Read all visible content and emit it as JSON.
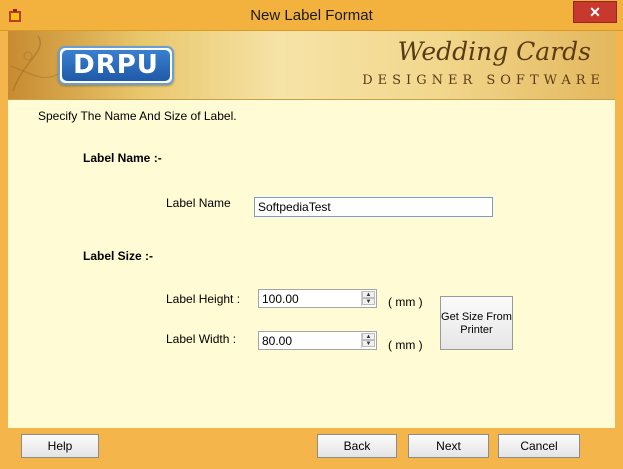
{
  "window": {
    "title": "New Label Format",
    "close_glyph": "✕"
  },
  "banner": {
    "logo_text": "DRPU",
    "brand_title": "Wedding Cards",
    "brand_subtitle": "DESIGNER SOFTWARE"
  },
  "content": {
    "instruction": "Specify The Name And Size of Label.",
    "name_section": {
      "heading": "Label Name :-",
      "field_label": "Label Name",
      "field_value": "SoftpediaTest"
    },
    "size_section": {
      "heading": "Label Size :-",
      "height_label": "Label Height :",
      "height_value": "100.00",
      "height_unit": "( mm )",
      "width_label": "Label Width :",
      "width_value": "80.00",
      "width_unit": "( mm )",
      "get_size_button": "Get Size From Printer"
    }
  },
  "footer": {
    "help": "Help",
    "back": "Back",
    "next": "Next",
    "cancel": "Cancel"
  },
  "icons": {
    "app": "app-icon",
    "close": "close-icon",
    "spin_up": "spin-up-icon",
    "spin_down": "spin-down-icon"
  },
  "colors": {
    "titlebar": "#f3b23e",
    "content_bg": "#fffbd4",
    "close_button": "#c7392f",
    "logo_blue": "#1f5aa8"
  }
}
